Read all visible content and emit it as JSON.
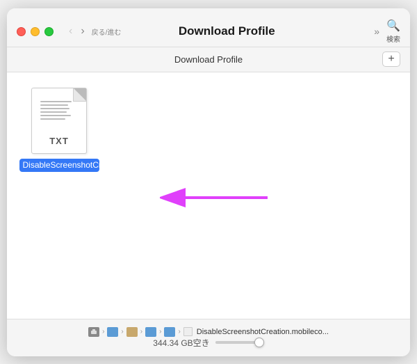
{
  "window": {
    "title": "Download Profile",
    "breadcrumb": "Download Profile"
  },
  "toolbar": {
    "nav_label": "戻る/進む",
    "search_label": "検索",
    "forward_arrows": "»",
    "add_btn": "+"
  },
  "file": {
    "name": "DisableScreenshotCreatio...ileconfig",
    "type": "TXT",
    "full_name": "DisableScreenshotCreation.mobileconfig"
  },
  "statusbar": {
    "path_segments": [
      "disk",
      "folder",
      "home",
      "folder",
      "folder",
      "file"
    ],
    "path_labels": [
      "▣",
      "⊡",
      "⌂",
      "⊡",
      "⊡",
      "DisableScreenshotCreation.mobileco..."
    ],
    "disk_space": "344.34 GB空き"
  }
}
